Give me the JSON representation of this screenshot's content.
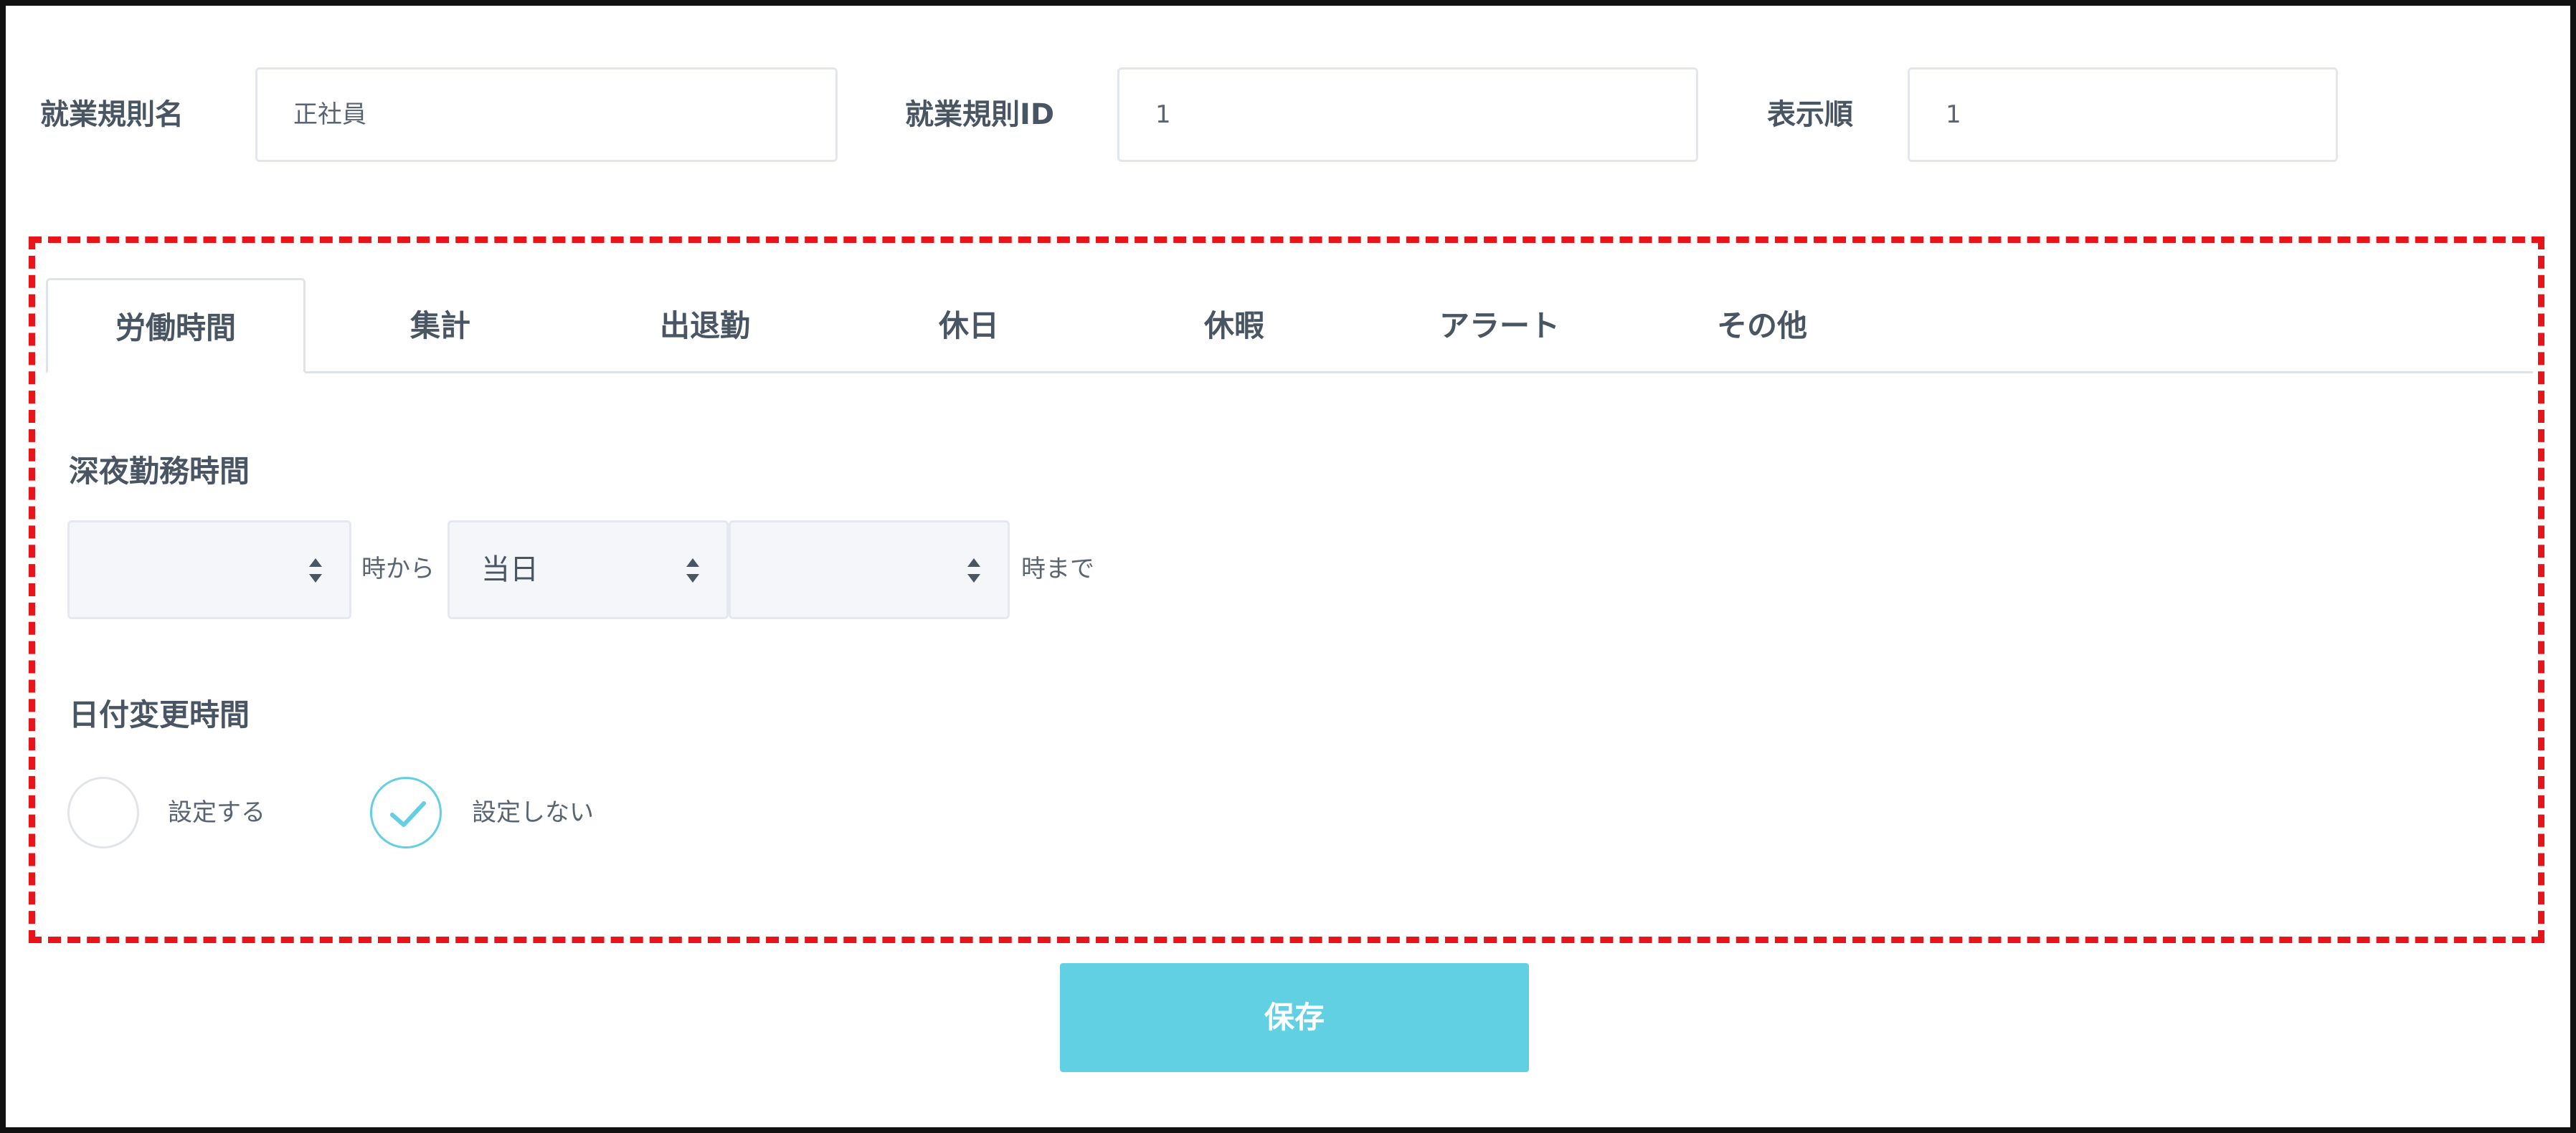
{
  "header": {
    "rule_name_label": "就業規則名",
    "rule_name_value": "正社員",
    "rule_id_label": "就業規則ID",
    "rule_id_value": "1",
    "display_order_label": "表示順",
    "display_order_value": "1"
  },
  "tabs": [
    {
      "label": "労働時間",
      "active": true
    },
    {
      "label": "集計",
      "active": false
    },
    {
      "label": "出退勤",
      "active": false
    },
    {
      "label": "休日",
      "active": false
    },
    {
      "label": "休暇",
      "active": false
    },
    {
      "label": "アラート",
      "active": false
    },
    {
      "label": "その他",
      "active": false
    }
  ],
  "night_work": {
    "title": "深夜勤務時間",
    "start_hour_value": "",
    "from_text": "時から",
    "day_value": "当日",
    "end_hour_value": "",
    "until_text": "時まで"
  },
  "date_change": {
    "title": "日付変更時間",
    "options": [
      {
        "label": "設定する",
        "checked": false
      },
      {
        "label": "設定しない",
        "checked": true
      }
    ]
  },
  "actions": {
    "save_label": "保存"
  },
  "colors": {
    "accent": "#62d0e3",
    "highlight_border": "#e8141a",
    "text": "#4a5563"
  },
  "icons": {
    "select_arrows": "chevron-up-down-icon",
    "check": "check-icon"
  }
}
